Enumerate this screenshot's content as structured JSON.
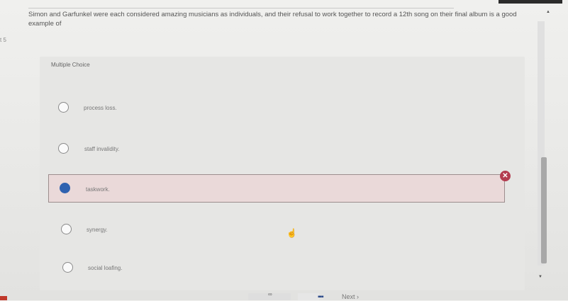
{
  "question": {
    "number_fragment": "t 5",
    "text": "Simon and Garfunkel were each considered amazing musicians as individuals, and their refusal to work together to record a 12th song on their final album is a good example of"
  },
  "question_type_label": "Multiple Choice",
  "options": [
    {
      "label": "process loss.",
      "selected": false
    },
    {
      "label": "staff invalidity.",
      "selected": false
    },
    {
      "label": "taskwork.",
      "selected": true,
      "marked_incorrect": true
    },
    {
      "label": "synergy.",
      "selected": false
    },
    {
      "label": "social loafing.",
      "selected": false
    }
  ],
  "incorrect_badge": "✕",
  "footer": {
    "next_label": "Next",
    "next_chevron": "›"
  },
  "colors": {
    "selected_radio": "#2f62b0",
    "incorrect_badge": "#b33c4f",
    "selected_row_bg": "#ead9d9"
  }
}
